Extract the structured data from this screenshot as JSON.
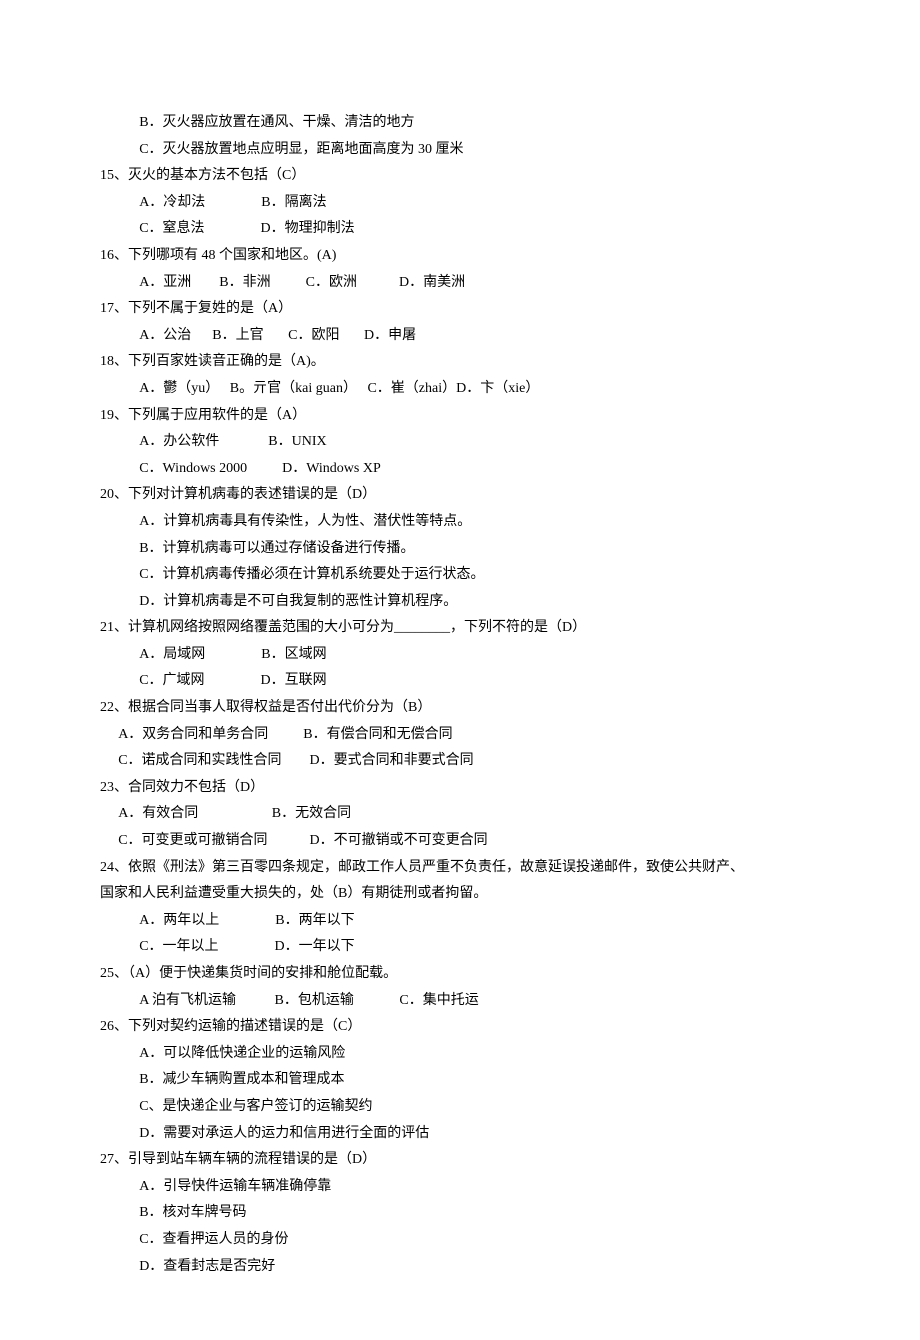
{
  "lines": [
    {
      "cls": "indent1",
      "text": "B．灭火器应放置在通风、干燥、清洁的地方"
    },
    {
      "cls": "indent1",
      "text": "C．灭火器放置地点应明显，距离地面高度为 30 厘米"
    },
    {
      "cls": "",
      "text": "15、灭火的基本方法不包括（C）"
    },
    {
      "cls": "indent1",
      "text": "A．冷却法                B．隔离法"
    },
    {
      "cls": "indent1",
      "text": "C．窒息法                D．物理抑制法"
    },
    {
      "cls": "",
      "text": "16、下列哪项有 48 个国家和地区。(A)"
    },
    {
      "cls": "indent1",
      "text": "A．亚洲        B．非洲          C．欧洲            D．南美洲"
    },
    {
      "cls": "",
      "text": "17、下列不属于复姓的是（A）"
    },
    {
      "cls": "indent1",
      "text": "A．公治      B．上官       C．欧阳       D．申屠"
    },
    {
      "cls": "",
      "text": "18、下列百家姓读音正确的是（A)。"
    },
    {
      "cls": "indent1",
      "text": "A．鬱（yu）   B。亓官（kai guan）   C．崔（zhai）D．卞（xie）"
    },
    {
      "cls": "",
      "text": "19、下列属于应用软件的是（A）"
    },
    {
      "cls": "indent1",
      "text": "A．办公软件              B．UNIX"
    },
    {
      "cls": "indent1",
      "text": "C．Windows 2000          D．Windows XP"
    },
    {
      "cls": "",
      "text": "20、下列对计算机病毒的表述错误的是（D）"
    },
    {
      "cls": "indent1",
      "text": "A．计算机病毒具有传染性，人为性、潜伏性等特点。"
    },
    {
      "cls": "indent1",
      "text": "B．计算机病毒可以通过存储设备进行传播。"
    },
    {
      "cls": "indent1",
      "text": "C．计算机病毒传播必须在计算机系统要处于运行状态。"
    },
    {
      "cls": "indent1",
      "text": "D．计算机病毒是不可自我复制的恶性计算机程序。"
    },
    {
      "cls": "",
      "text": "21、计算机网络按照网络覆盖范围的大小可分为________，下列不符的是（D）"
    },
    {
      "cls": "indent1",
      "text": "A．局域网                B．区域网"
    },
    {
      "cls": "indent1",
      "text": "C．广域网                D．互联网"
    },
    {
      "cls": "",
      "text": "22、根据合同当事人取得权益是否付出代价分为（B）"
    },
    {
      "cls": "indent2",
      "text": "A．双务合同和单务合同          B．有偿合同和无偿合同"
    },
    {
      "cls": "indent2",
      "text": "C．诺成合同和实践性合同        D．要式合同和非要式合同"
    },
    {
      "cls": "",
      "text": "23、合同效力不包括（D）"
    },
    {
      "cls": "indent2",
      "text": "A．有效合同                     B．无效合同"
    },
    {
      "cls": "indent2",
      "text": "C．可变更或可撤销合同            D．不可撤销或不可变更合同"
    },
    {
      "cls": "",
      "text": "24、依照《刑法》第三百零四条规定，邮政工作人员严重不负责任，故意延误投递邮件，致使公共财产、"
    },
    {
      "cls": "",
      "text": "国家和人民利益遭受重大损失的，处（B）有期徒刑或者拘留。"
    },
    {
      "cls": "indent1",
      "text": "A．两年以上                B．两年以下"
    },
    {
      "cls": "indent1",
      "text": "C．一年以上                D．一年以下"
    },
    {
      "cls": "",
      "text": "25、（A）便于快递集货时间的安排和舱位配载。"
    },
    {
      "cls": "indent1",
      "text": "A 泊有飞机运输           B．包机运输             C．集中托运"
    },
    {
      "cls": "",
      "text": "26、下列对契约运输的描述错误的是（C）"
    },
    {
      "cls": "indent1",
      "text": "A．可以降低快递企业的运输风险"
    },
    {
      "cls": "indent1",
      "text": "B．减少车辆购置成本和管理成本"
    },
    {
      "cls": "indent1",
      "text": "C、是快递企业与客户签订的运输契约"
    },
    {
      "cls": "indent1",
      "text": "D．需要对承运人的运力和信用进行全面的评估"
    },
    {
      "cls": "",
      "text": "27、引导到站车辆车辆的流程错误的是（D）"
    },
    {
      "cls": "indent1",
      "text": "A．引导快件运输车辆准确停靠"
    },
    {
      "cls": "indent1",
      "text": "B．核对车牌号码"
    },
    {
      "cls": "indent1",
      "text": "C．查看押运人员的身份"
    },
    {
      "cls": "indent1",
      "text": "D．查看封志是否完好"
    }
  ]
}
